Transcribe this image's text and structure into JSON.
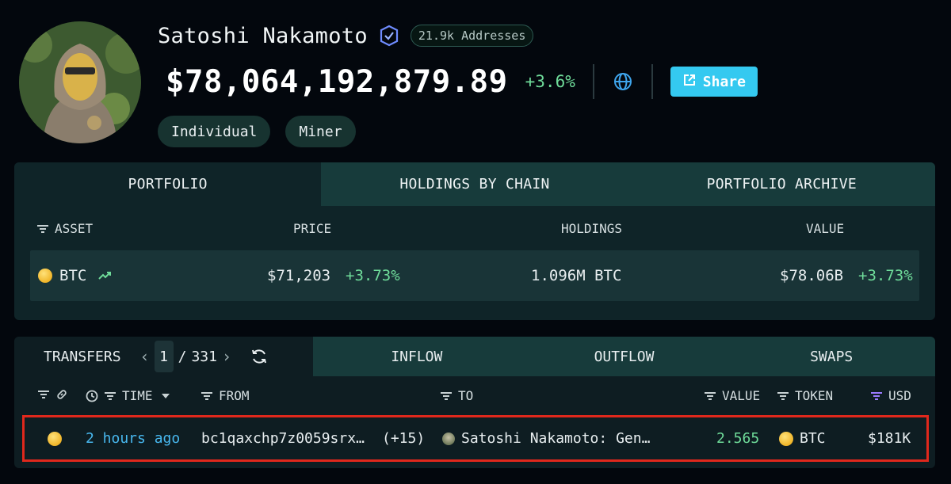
{
  "profile": {
    "name": "Satoshi Nakamoto",
    "addresses_badge": "21.9k Addresses",
    "total_value": "$78,064,192,879.89",
    "total_change": "+3.6%",
    "share_label": "Share",
    "tags": [
      "Individual",
      "Miner"
    ]
  },
  "portfolio": {
    "tabs": [
      "PORTFOLIO",
      "HOLDINGS BY CHAIN",
      "PORTFOLIO ARCHIVE"
    ],
    "columns": {
      "asset": "ASSET",
      "price": "PRICE",
      "holdings": "HOLDINGS",
      "value": "VALUE"
    },
    "rows": [
      {
        "asset": "BTC",
        "price": "$71,203",
        "price_change": "+3.73%",
        "holdings": "1.096M BTC",
        "value": "$78.06B",
        "value_change": "+3.73%"
      }
    ]
  },
  "transfers": {
    "title": "TRANSFERS",
    "page_current": "1",
    "page_sep": "/",
    "page_total": "331",
    "tabs": [
      "INFLOW",
      "OUTFLOW",
      "SWAPS"
    ],
    "columns": {
      "time": "TIME",
      "from": "FROM",
      "to": "TO",
      "value": "VALUE",
      "token": "TOKEN",
      "usd": "USD"
    },
    "rows": [
      {
        "time": "2 hours ago",
        "from": "bc1qaxchp7z0059srx…",
        "from_extra": "(+15)",
        "to": "Satoshi Nakamoto: Gen…",
        "value": "2.565",
        "token": "BTC",
        "usd": "$181K"
      }
    ]
  },
  "colors": {
    "accent": "#34c9f0",
    "positive": "#6fdc9a",
    "link": "#48b8ef",
    "highlight": "#e0281c",
    "panel": "#0f2428"
  },
  "icons": [
    "verified-badge-icon",
    "globe-icon",
    "external-link-icon",
    "filter-icon",
    "link-icon",
    "clock-icon",
    "caret-down-icon",
    "trend-up-icon",
    "refresh-icon",
    "btc-coin-icon"
  ]
}
